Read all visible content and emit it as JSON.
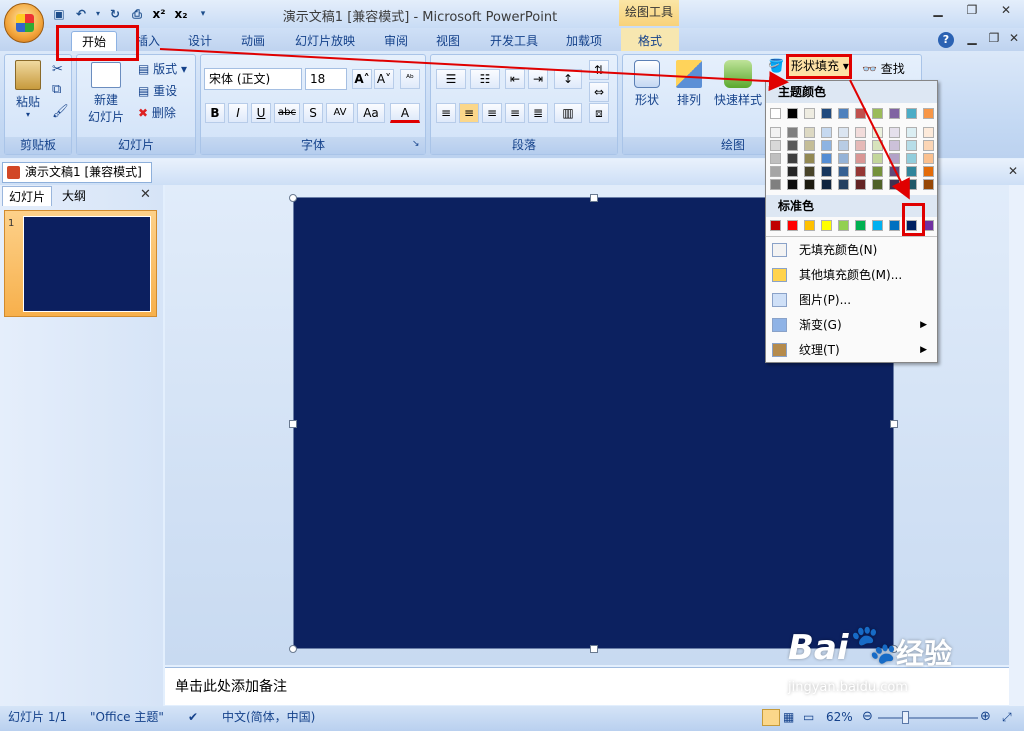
{
  "titlebar": {
    "doc_title": "演示文稿1 [兼容模式] - Microsoft PowerPoint",
    "context_tool": "绘图工具"
  },
  "qat": {
    "undo": "↶",
    "redo": "↻",
    "sup": "x²",
    "sub": "x₂"
  },
  "tabs": [
    "开始",
    "插入",
    "设计",
    "动画",
    "幻灯片放映",
    "审阅",
    "视图",
    "开发工具",
    "加载项",
    "格式"
  ],
  "ribbon": {
    "clipboard": {
      "paste": "粘贴",
      "label": "剪贴板"
    },
    "slides": {
      "new_slide": "新建",
      "new_slide2": "幻灯片",
      "layout": "版式",
      "reset": "重设",
      "delete": "删除",
      "label": "幻灯片"
    },
    "font": {
      "name": "宋体 (正文)",
      "size": "18",
      "label": "字体",
      "bold": "B",
      "italic": "I",
      "underline": "U",
      "strike": "abc",
      "shadow": "S",
      "spacing": "AV",
      "case": "Aa",
      "color": "A"
    },
    "paragraph": {
      "label": "段落"
    },
    "drawing": {
      "shapes": "形状",
      "arrange": "排列",
      "quick_styles": "快速样式",
      "label": "绘图",
      "shape_fill": "形状填充",
      "find": "查找"
    }
  },
  "doc_tab": "演示文稿1 [兼容模式]",
  "pane_tabs": [
    "幻灯片",
    "大纲"
  ],
  "slide_number": "1",
  "notes_placeholder": "单击此处添加备注",
  "dropdown": {
    "theme_header": "主题颜色",
    "standard_header": "标准色",
    "items": [
      {
        "label": "无填充颜色(N)",
        "icon": "no-fill-icon"
      },
      {
        "label": "其他填充颜色(M)...",
        "icon": "palette-icon"
      },
      {
        "label": "图片(P)...",
        "icon": "picture-icon"
      },
      {
        "label": "渐变(G)",
        "icon": "gradient-icon",
        "submenu": true
      },
      {
        "label": "纹理(T)",
        "icon": "texture-icon",
        "submenu": true
      }
    ],
    "theme_top": [
      "#ffffff",
      "#000000",
      "#eeece1",
      "#1f497d",
      "#4f81bd",
      "#c0504d",
      "#9bbb59",
      "#8064a2",
      "#4bacc6",
      "#f79646"
    ],
    "theme_shades": [
      [
        "#f2f2f2",
        "#7f7f7f",
        "#ddd9c3",
        "#c6d9f0",
        "#dbe5f1",
        "#f2dcdb",
        "#ebf1dd",
        "#e5e0ec",
        "#dbeef3",
        "#fdeada"
      ],
      [
        "#d8d8d8",
        "#595959",
        "#c4bd97",
        "#8db3e2",
        "#b8cce4",
        "#e5b9b7",
        "#d7e3bc",
        "#ccc1d9",
        "#b7dde8",
        "#fbd5b5"
      ],
      [
        "#bfbfbf",
        "#3f3f3f",
        "#938953",
        "#548dd4",
        "#95b3d7",
        "#d99694",
        "#c3d69b",
        "#b2a2c7",
        "#92cddc",
        "#fac08f"
      ],
      [
        "#a5a5a5",
        "#262626",
        "#494429",
        "#17365d",
        "#366092",
        "#953734",
        "#76923c",
        "#5f497a",
        "#31859b",
        "#e36c09"
      ],
      [
        "#7f7f7f",
        "#0c0c0c",
        "#1d1b10",
        "#0f243e",
        "#244061",
        "#632423",
        "#4f6128",
        "#3f3151",
        "#205867",
        "#974806"
      ]
    ],
    "standard": [
      "#c00000",
      "#ff0000",
      "#ffc000",
      "#ffff00",
      "#92d050",
      "#00b050",
      "#00b0f0",
      "#0070c0",
      "#002060",
      "#7030a0"
    ]
  },
  "status": {
    "slide": "幻灯片 1/1",
    "theme": "\"Office 主题\"",
    "lang": "中文(简体，中国)",
    "zoom": "62%"
  },
  "watermark": {
    "brand": "Bai",
    "brand2": "经验",
    "url": "jingyan.baidu.com"
  },
  "accent": "#e00000",
  "slide_fill": "#0c2160"
}
